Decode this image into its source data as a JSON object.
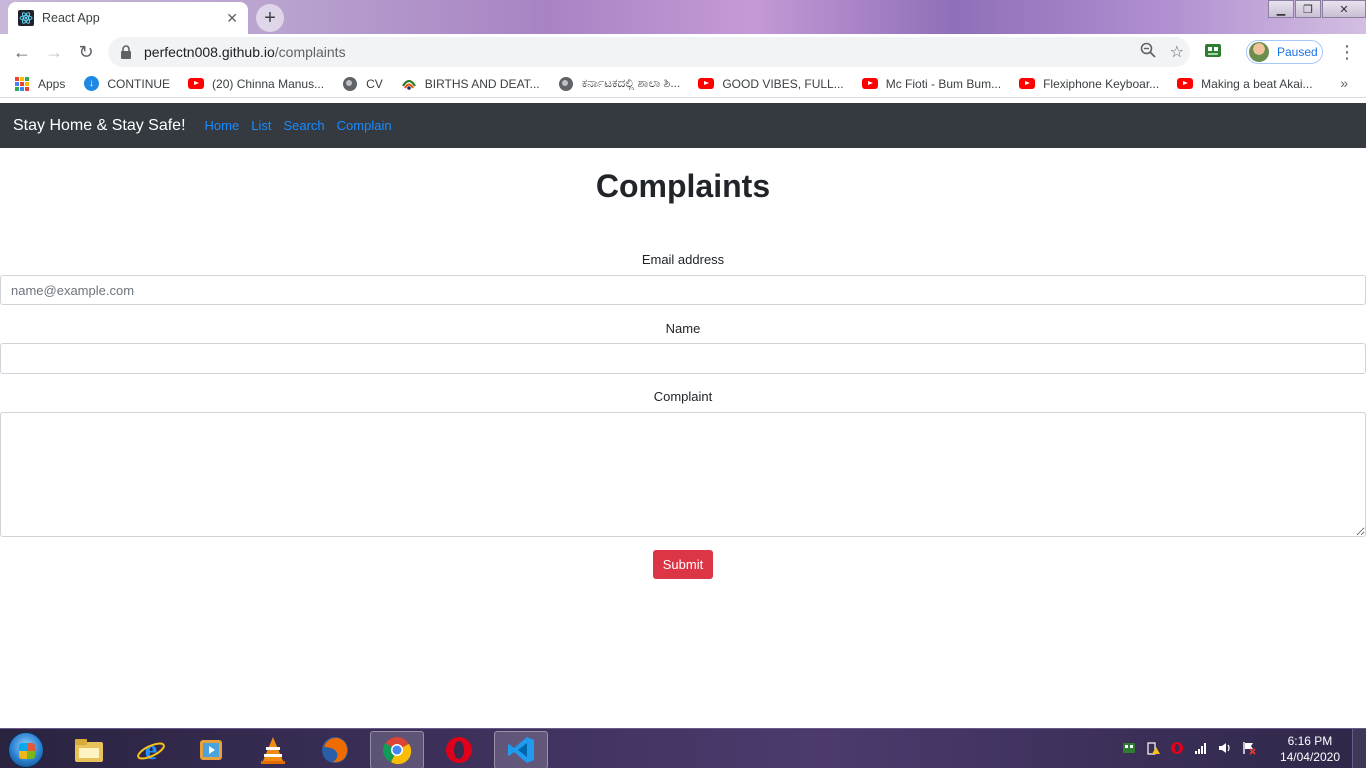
{
  "browser": {
    "tab_title": "React App",
    "url_host": "perfectn008.github.io",
    "url_path": "/complaints",
    "profile_status": "Paused"
  },
  "bookmarks": [
    {
      "label": "Apps",
      "icon": "apps-grid-icon"
    },
    {
      "label": "CONTINUE",
      "icon": "download-icon"
    },
    {
      "label": "(20) Chinna Manus...",
      "icon": "youtube-icon"
    },
    {
      "label": "CV",
      "icon": "globe-icon"
    },
    {
      "label": "BIRTHS AND DEAT...",
      "icon": "site-icon"
    },
    {
      "label": "ಕರ್ನಾಟಕದಲ್ಲಿ ಶಾಲಾ ಶಿ...",
      "icon": "globe-icon"
    },
    {
      "label": "GOOD VIBES, FULL...",
      "icon": "youtube-icon"
    },
    {
      "label": "Mc Fioti - Bum Bum...",
      "icon": "youtube-icon"
    },
    {
      "label": "Flexiphone Keyboar...",
      "icon": "youtube-icon"
    },
    {
      "label": "Making a beat Akai...",
      "icon": "youtube-icon"
    }
  ],
  "navbar": {
    "brand": "Stay Home & Stay Safe!",
    "links": [
      "Home",
      "List",
      "Search",
      "Complain"
    ],
    "link_color": "#1a8cff",
    "bg_color": "#343a40"
  },
  "page": {
    "title": "Complaints",
    "email_label": "Email address",
    "email_placeholder": "name@example.com",
    "name_label": "Name",
    "complaint_label": "Complaint",
    "submit_label": "Submit",
    "submit_color": "#dc3545"
  },
  "taskbar": {
    "time": "6:16 PM",
    "date": "14/04/2020"
  }
}
